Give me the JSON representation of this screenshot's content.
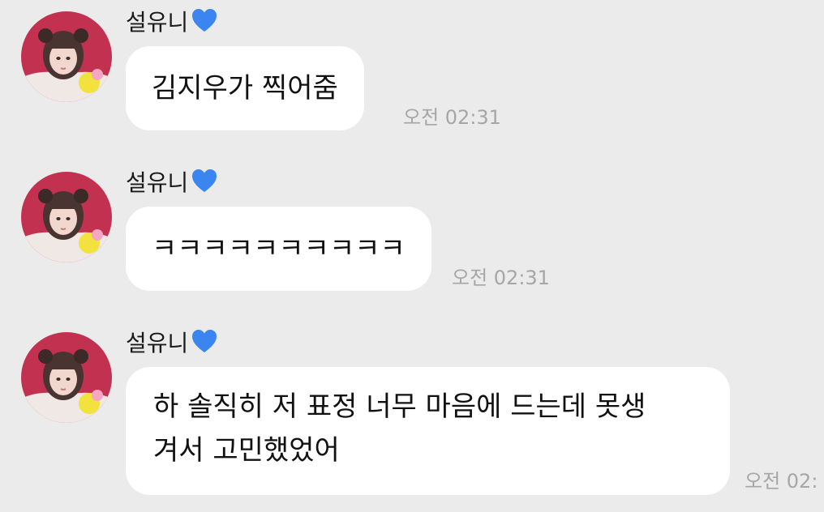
{
  "contact": {
    "name": "설유니",
    "heart_icon": "blue-heart-emoji",
    "heart_color": "#3a85f0"
  },
  "messages": [
    {
      "text": "김지우가 찍어줌",
      "time": "오전 02:31"
    },
    {
      "text": "ㅋㅋㅋㅋㅋㅋㅋㅋㅋㅋ",
      "time": "오전 02:31"
    },
    {
      "text": "하 솔직히 저 표정 너무 마음에 드는데 못생\n겨서 고민했었어",
      "time": "오전 02:"
    }
  ],
  "colors": {
    "background": "#ebebeb",
    "bubble": "#ffffff",
    "timestamp": "#a6a6a6"
  }
}
